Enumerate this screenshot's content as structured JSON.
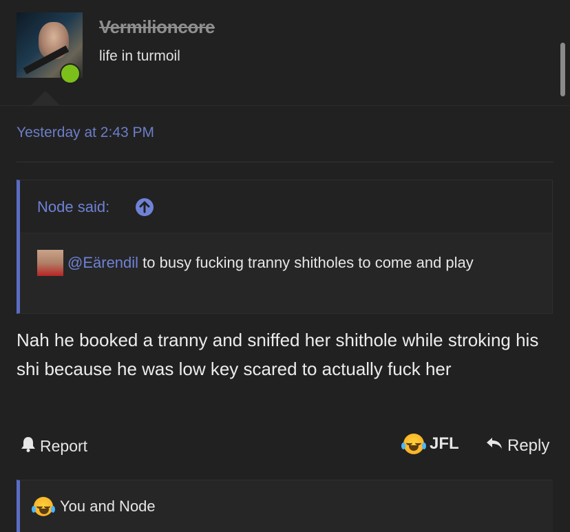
{
  "user": {
    "name": "Vermilioncore",
    "title": "life in turmoil",
    "online_color": "#7cbf1b"
  },
  "post": {
    "timestamp": "Yesterday at 2:43 PM",
    "quote": {
      "author_label": "Node said:",
      "mention": "@Eärendil",
      "text": " to busy fucking tranny shitholes to come and play"
    },
    "message": "Nah he booked a tranny and sniffed her shithole while stroking his shi because he was low key scared to actually fuck her"
  },
  "actions": {
    "report_label": "Report",
    "jfl_label": "JFL",
    "reply_label": "Reply"
  },
  "reactions": {
    "text": "You and Node"
  },
  "colors": {
    "accent": "#6f82d6",
    "background": "#212121"
  }
}
